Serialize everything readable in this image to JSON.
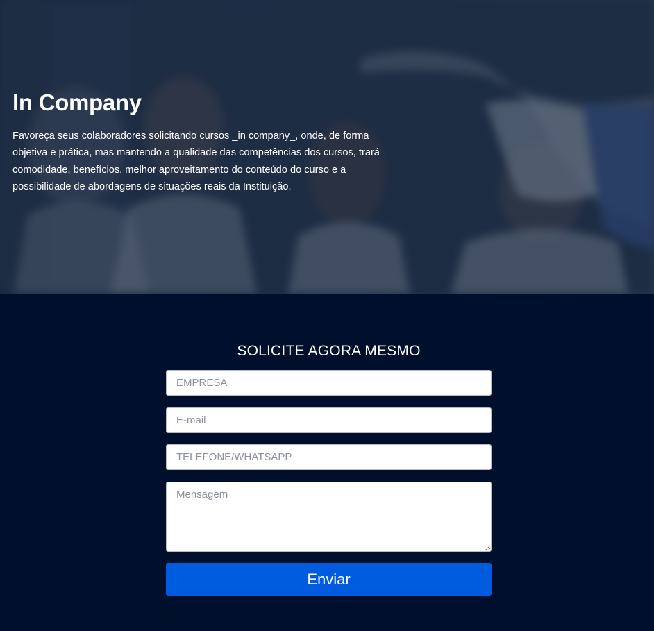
{
  "hero": {
    "title": "In Company",
    "description": "Favoreça seus colaboradores solicitando cursos _in company_, onde, de forma objetiva e prática, mas mantendo a qualidade das competências dos cursos, trará comodidade, benefícios, melhor aproveitamento do conteúdo do curso e a possibilidade de abordagens de situações reais da Instituição."
  },
  "form": {
    "title": "SOLICITE AGORA MESMO",
    "company_placeholder": "EMPRESA",
    "email_placeholder": "E-mail",
    "phone_placeholder": "TELEFONE/WHATSAPP",
    "message_placeholder": "Mensagem",
    "submit_label": "Enviar"
  },
  "colors": {
    "background": "#000f2b",
    "button": "#005cdf",
    "text": "#ffffff"
  }
}
